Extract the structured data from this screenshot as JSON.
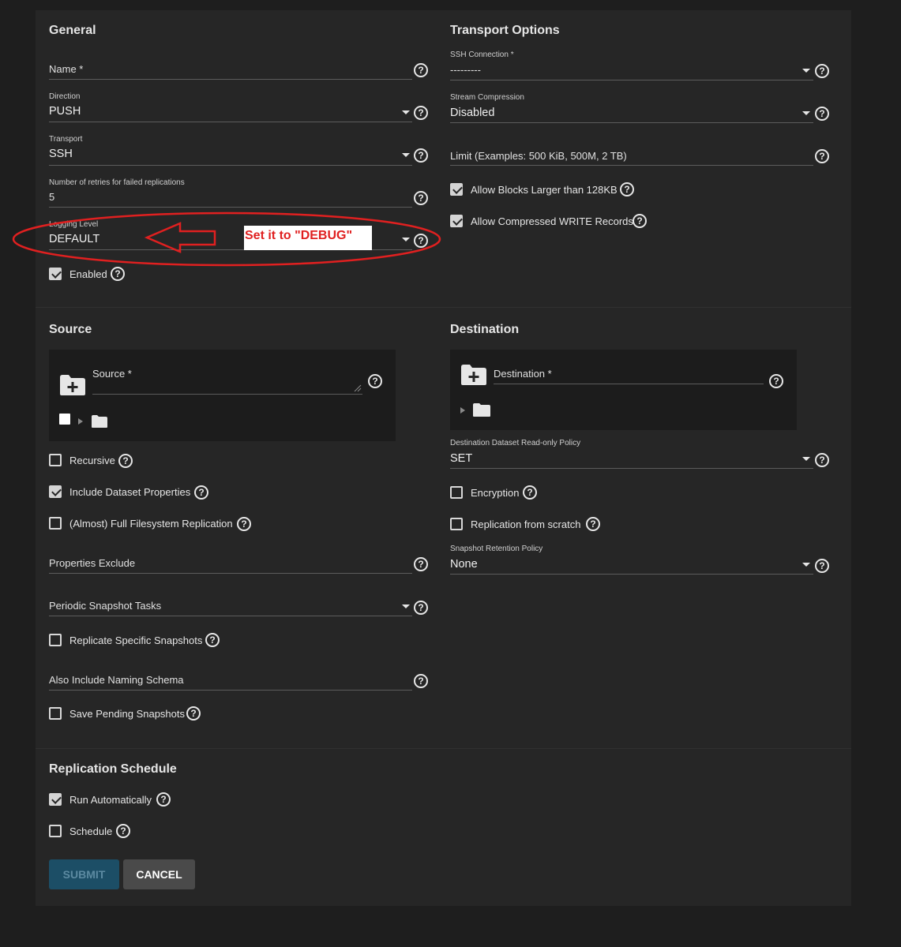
{
  "general": {
    "title": "General",
    "name_label": "Name *",
    "direction_label": "Direction",
    "direction_value": "PUSH",
    "transport_label": "Transport",
    "transport_value": "SSH",
    "retries_label": "Number of retries for failed replications",
    "retries_value": "5",
    "logging_label": "Logging Level",
    "logging_value": "DEFAULT",
    "enabled_label": "Enabled"
  },
  "annotation": {
    "text": "Set it to \"DEBUG\"",
    "color": "#e02020"
  },
  "transport_options": {
    "title": "Transport Options",
    "ssh_label": "SSH Connection *",
    "ssh_value": "---------",
    "compression_label": "Stream Compression",
    "compression_value": "Disabled",
    "limit_placeholder": "Limit (Examples: 500 KiB, 500M, 2 TB)",
    "allow_blocks_label": "Allow Blocks Larger than 128KB",
    "allow_compressed_label": "Allow Compressed WRITE Records"
  },
  "source": {
    "title": "Source",
    "source_label": "Source *",
    "recursive_label": "Recursive",
    "include_props_label": "Include Dataset Properties",
    "full_fs_label": "(Almost) Full Filesystem Replication",
    "props_exclude_label": "Properties Exclude",
    "periodic_tasks_label": "Periodic Snapshot Tasks",
    "replicate_specific_label": "Replicate Specific Snapshots",
    "naming_schema_label": "Also Include Naming Schema",
    "save_pending_label": "Save Pending Snapshots"
  },
  "destination": {
    "title": "Destination",
    "destination_label": "Destination *",
    "readonly_policy_label": "Destination Dataset Read-only Policy",
    "readonly_policy_value": "SET",
    "encryption_label": "Encryption",
    "from_scratch_label": "Replication from scratch",
    "retention_label": "Snapshot Retention Policy",
    "retention_value": "None"
  },
  "schedule": {
    "title": "Replication Schedule",
    "run_auto_label": "Run Automatically",
    "schedule_label": "Schedule"
  },
  "buttons": {
    "submit": "SUBMIT",
    "cancel": "CANCEL"
  },
  "icons": {
    "help": "?"
  }
}
